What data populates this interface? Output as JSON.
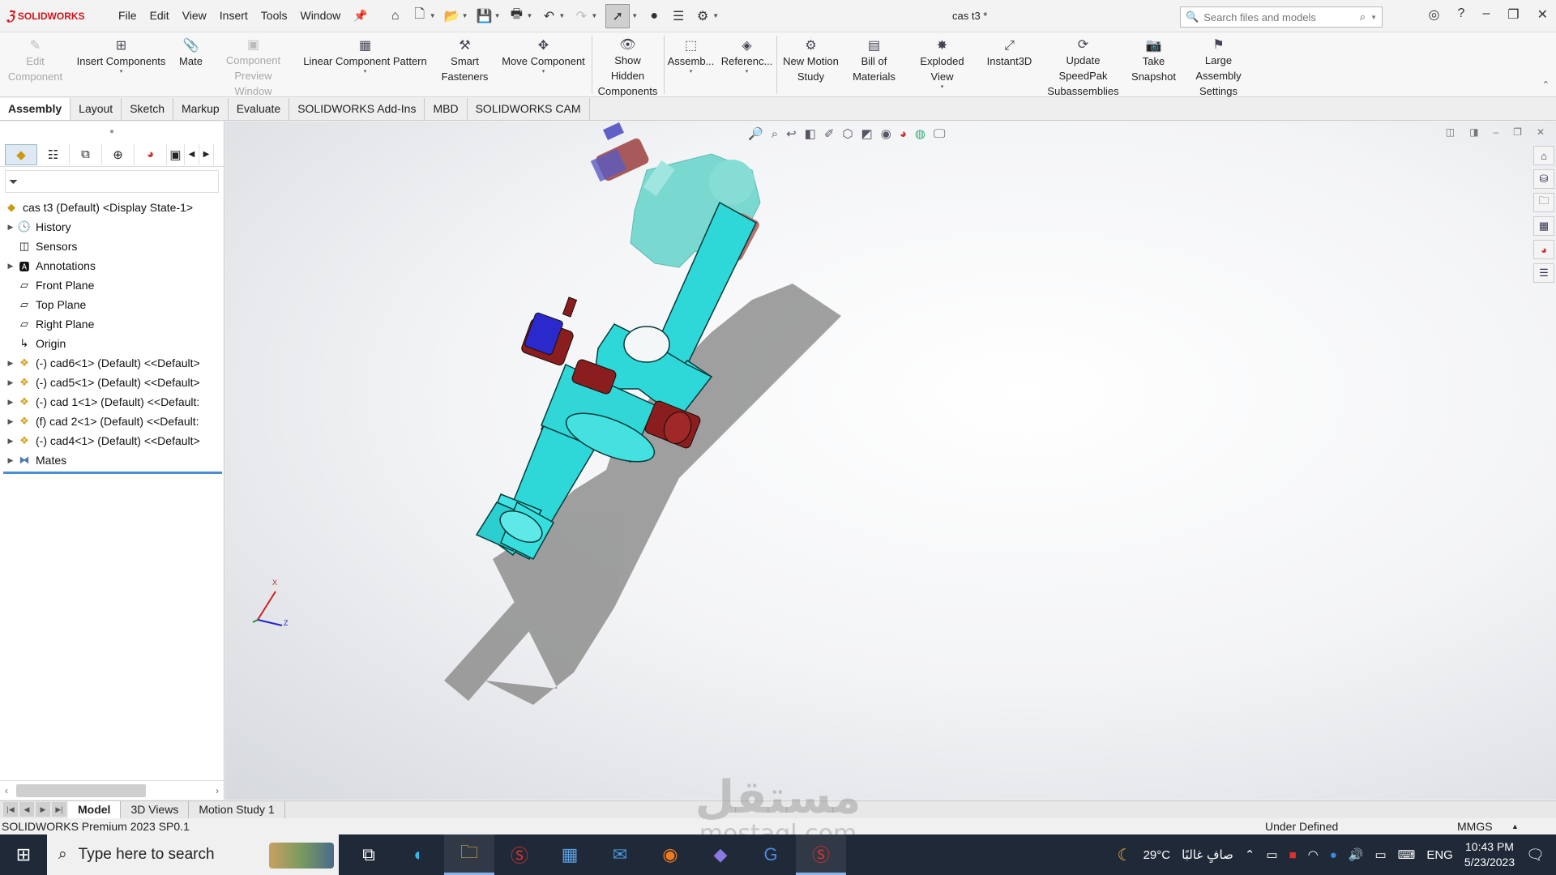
{
  "app": {
    "logo_text": "SOLIDWORKS",
    "document_title": "cas t3 *",
    "menus": [
      "File",
      "Edit",
      "View",
      "Insert",
      "Tools",
      "Window"
    ],
    "search_placeholder": "Search files and models"
  },
  "ribbon": {
    "buttons": [
      {
        "label": "Edit Component",
        "disabled": true,
        "icon": "edit-component-icon"
      },
      {
        "label": "Insert Components",
        "disabled": false,
        "icon": "insert-components-icon"
      },
      {
        "label": "Mate",
        "disabled": false,
        "icon": "mate-icon"
      },
      {
        "label": "Component Preview Window",
        "disabled": true,
        "icon": "preview-window-icon"
      },
      {
        "label": "Linear Component Pattern",
        "disabled": false,
        "icon": "pattern-icon"
      },
      {
        "label": "Smart Fasteners",
        "disabled": false,
        "icon": "fastener-icon"
      },
      {
        "label": "Move Component",
        "disabled": false,
        "icon": "move-component-icon"
      },
      {
        "label": "Show Hidden Components",
        "disabled": false,
        "icon": "show-hidden-icon"
      },
      {
        "label": "Assemb...",
        "disabled": false,
        "icon": "assembly-features-icon"
      },
      {
        "label": "Referenc...",
        "disabled": false,
        "icon": "reference-geometry-icon"
      },
      {
        "label": "New Motion Study",
        "disabled": false,
        "icon": "motion-study-icon"
      },
      {
        "label": "Bill of Materials",
        "disabled": false,
        "icon": "bom-icon"
      },
      {
        "label": "Exploded View",
        "disabled": false,
        "icon": "exploded-view-icon"
      },
      {
        "label": "Instant3D",
        "disabled": false,
        "icon": "instant3d-icon"
      },
      {
        "label": "Update SpeedPak Subassemblies",
        "disabled": false,
        "icon": "speedpak-icon"
      },
      {
        "label": "Take Snapshot",
        "disabled": false,
        "icon": "camera-icon"
      },
      {
        "label": "Large Assembly Settings",
        "disabled": false,
        "icon": "large-assembly-icon"
      }
    ]
  },
  "tabs": [
    "Assembly",
    "Layout",
    "Sketch",
    "Markup",
    "Evaluate",
    "SOLIDWORKS Add-Ins",
    "MBD",
    "SOLIDWORKS CAM"
  ],
  "active_tab": "Assembly",
  "feature_tree": {
    "root": "cas t3 (Default) <Display State-1>",
    "nodes": [
      {
        "label": "History",
        "expandable": true,
        "icon": "history-icon"
      },
      {
        "label": "Sensors",
        "expandable": false,
        "icon": "sensors-icon"
      },
      {
        "label": "Annotations",
        "expandable": true,
        "icon": "annotations-icon"
      },
      {
        "label": "Front Plane",
        "expandable": false,
        "icon": "plane-icon"
      },
      {
        "label": "Top Plane",
        "expandable": false,
        "icon": "plane-icon"
      },
      {
        "label": "Right Plane",
        "expandable": false,
        "icon": "plane-icon"
      },
      {
        "label": "Origin",
        "expandable": false,
        "icon": "origin-icon"
      },
      {
        "label": "(-) cad6<1> (Default) <<Default>",
        "expandable": true,
        "icon": "part-icon"
      },
      {
        "label": "(-) cad5<1> (Default) <<Default>",
        "expandable": true,
        "icon": "part-icon"
      },
      {
        "label": "(-) cad 1<1> (Default) <<Default:",
        "expandable": true,
        "icon": "part-icon"
      },
      {
        "label": "(f) cad 2<1> (Default) <<Default:",
        "expandable": true,
        "icon": "part-icon"
      },
      {
        "label": "(-) cad4<1> (Default) <<Default>",
        "expandable": true,
        "icon": "part-icon"
      },
      {
        "label": "Mates",
        "expandable": true,
        "icon": "mates-icon"
      }
    ]
  },
  "triad": {
    "x_label": "X",
    "z_label": "Z"
  },
  "bottom_tabs": [
    "Model",
    "3D Views",
    "Motion Study 1"
  ],
  "active_bottom_tab": "Model",
  "status": {
    "product": "SOLIDWORKS Premium 2023 SP0.1",
    "state": "Under Defined",
    "units": "MMGS"
  },
  "taskbar": {
    "search_placeholder": "Type here to search",
    "weather_temp": "29°C",
    "weather_text": "صافٍ غالبًا",
    "language": "ENG",
    "time": "10:43 PM",
    "date": "5/23/2023"
  },
  "watermark": {
    "arabic": "مستقل",
    "latin": "mostaql.com"
  },
  "colors": {
    "accent_red": "#d0151b",
    "model_cyan": "#2fd8d8",
    "model_teal": "#7fd6d0",
    "bolt_red": "#8a1e1e",
    "nut_blue": "#2a2acc",
    "taskbar": "#202938"
  }
}
